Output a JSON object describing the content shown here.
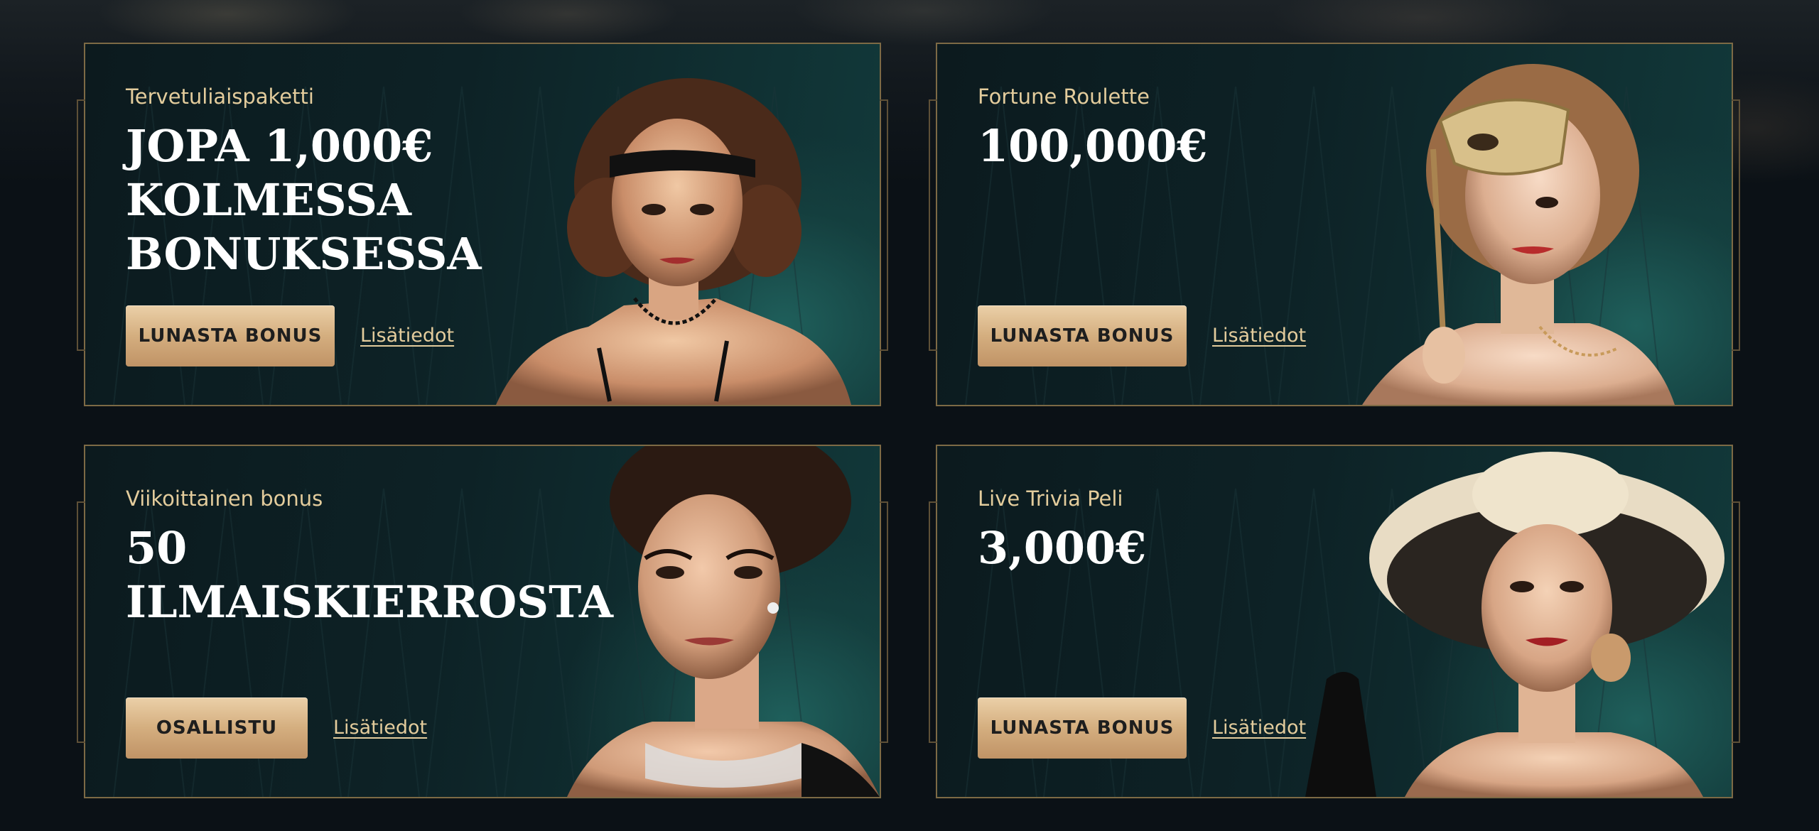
{
  "promotions": [
    {
      "label": "Tervetuliaispaketti",
      "title_lines": [
        "JOPA 1,000€",
        "KOLMESSA",
        "BONUKSESSA"
      ],
      "button": "LUNASTA BONUS",
      "link": "Lisätiedot",
      "portrait": "flapper-woman-headband-image"
    },
    {
      "label": "Fortune Roulette",
      "title_lines": [
        "100,000€"
      ],
      "button": "LUNASTA BONUS",
      "link": "Lisätiedot",
      "portrait": "woman-masquerade-mask-image"
    },
    {
      "label": "Viikoittainen bonus",
      "title_lines": [
        "50",
        "ILMAISKIERROSTA"
      ],
      "button": "OSALLISTU",
      "link": "Lisätiedot",
      "portrait": "woman-pearl-necklace-image"
    },
    {
      "label": "Live Trivia Peli",
      "title_lines": [
        "3,000€"
      ],
      "button": "LUNASTA BONUS",
      "link": "Lisätiedot",
      "portrait": "woman-wide-hat-image"
    }
  ],
  "colors": {
    "background": "#0b1116",
    "card_border": "#7d6a45",
    "label_gold": "#e3cc9c",
    "button_gold": "#d4ae7f",
    "card_teal": "#123a3b"
  }
}
